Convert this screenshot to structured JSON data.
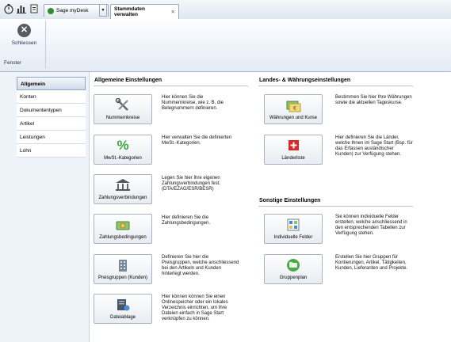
{
  "tabs": [
    {
      "label": "Sage myDesk"
    },
    {
      "label": "Stammdaten verwalten"
    }
  ],
  "ribbon": {
    "close_label": "Schliessen",
    "group_label": "Fenster"
  },
  "nav": [
    "Allgemein",
    "Konten",
    "Dokumententypen",
    "Artikel",
    "Leistungen",
    "Lohn"
  ],
  "sections": {
    "general": "Allgemeine Einstellungen",
    "country": "Landes- & Währungseinstellungen",
    "other": "Sonstige Einstellungen"
  },
  "tiles": {
    "nummernkreise": {
      "label": "Nummernkreise",
      "desc": "Hier können Sie die Nummernkreise, wie z. B. die Belegnummern definieren."
    },
    "mwst": {
      "label": "MwSt.-Kategorien",
      "desc": "Hier verwalten Sie die definierten MwSt.-Kategorien."
    },
    "zahlungsverbindungen": {
      "label": "Zahlungsverbindungen",
      "desc": "Legen Sie hier Ihre eigenen Zahlungsverbindungen fest. (DTA/EZAG/ESR/BESR)"
    },
    "zahlungsbedingungen": {
      "label": "Zahlungsbedingungen",
      "desc": "Hier definieren Sie die Zahlungsbedingungen."
    },
    "preisgruppen": {
      "label": "Preisgruppen (Kunden)",
      "desc": "Definieren Sie hier die Preisgruppen, welche anschliessend bei den Artikeln und Kunden hinterlegt werden."
    },
    "dateiablage": {
      "label": "Dateiablage",
      "desc": "Hier können können Sie einen Onlinespeicher oder ein lokales Verzeichnis einrichten, um Ihre Dateien einfach in Sage Start verknüpfen zu können."
    },
    "waehrungen": {
      "label": "Währungen und Kurse",
      "desc": "Bestimmen Sie hier Ihre Währungen sowie die aktuellen Tageskurse."
    },
    "laender": {
      "label": "Länderliste",
      "desc": "Hier definieren Sie die Länder, welche Ihnen im Sage Start (Bsp. für das Erfassen ausländischer Kunden) zur Verfügung stehen."
    },
    "felder": {
      "label": "Individuelle Felder",
      "desc": "Sie können individuelle Felder erstellen, welche anschliessend in den entsprechenden Tabellen zur Verfügung stehen."
    },
    "gruppenplan": {
      "label": "Gruppenplan",
      "desc": "Erstellen Sie hier Gruppen für Kontierungen, Artikel, Tätigkeiten, Kunden, Lieferanten und Projekte."
    }
  }
}
